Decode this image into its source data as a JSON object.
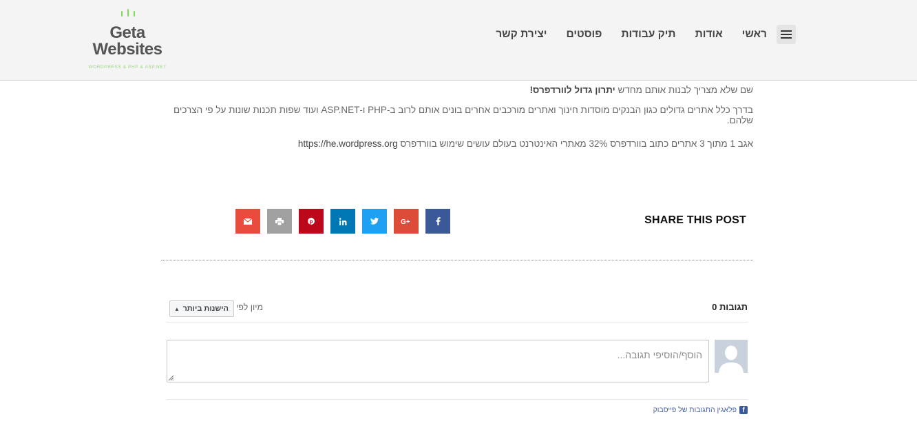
{
  "header": {
    "logo": {
      "line1": "Geta",
      "line2": "Websites",
      "tagline": "WORDPRESS & PHP & ASP.NET"
    },
    "nav": [
      {
        "label": "ראשי"
      },
      {
        "label": "אודות"
      },
      {
        "label": "תיק עבודות"
      },
      {
        "label": "פוסטים"
      },
      {
        "label": "יצירת קשר"
      }
    ]
  },
  "article": {
    "p1_text": "שם שלא מצריך לבנות אותם מחדש ",
    "p1_bold": "יתרון גדול לוורדפרס!",
    "p2": "בדרך כלל אתרים גדולים כגון הבנקים מוסדות חינוך ואתרים מורכבים אחרים בונים אותם לרוב ב-PHP ו-ASP.NET ועוד שפות תכנות שונות על פי הצרכים שלהם.",
    "p3_text": "אגב 1 מתוך 3 אתרים כתוב בוורדפרס 32% מאתרי האינטרנט בעולם עושים שימוש בוורדפרס ",
    "p3_link": "https://he.wordpress.org"
  },
  "share": {
    "title": "SHARE THIS POST",
    "buttons": [
      {
        "icon": "facebook-icon",
        "color": "#3b5998"
      },
      {
        "icon": "google-plus-icon",
        "color": "#dd4b39"
      },
      {
        "icon": "twitter-icon",
        "color": "#1da1f2"
      },
      {
        "icon": "linkedin-icon",
        "color": "#0077b5"
      },
      {
        "icon": "pinterest-icon",
        "color": "#bd081c"
      },
      {
        "icon": "print-icon",
        "color": "#a0a0a0"
      },
      {
        "icon": "email-icon",
        "color": "#e74c3c"
      }
    ]
  },
  "comments": {
    "count_label": "0 תגובות",
    "sort_label": "מיון לפי",
    "sort_value": "הישנות ביותר",
    "placeholder": "הוסף/הוסיפי תגובה...",
    "plugin_label": "פלאגין התגובות של פייסבוק"
  }
}
